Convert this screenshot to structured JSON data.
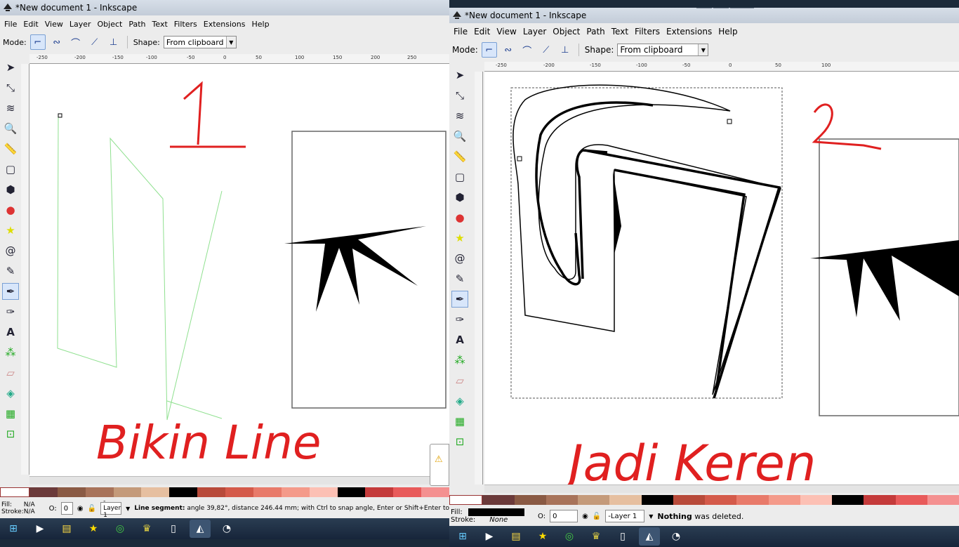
{
  "left": {
    "title": "*New document 1 - Inkscape",
    "menu": [
      "File",
      "Edit",
      "View",
      "Layer",
      "Object",
      "Path",
      "Text",
      "Filters",
      "Extensions",
      "Help"
    ],
    "mode_label": "Mode:",
    "shape_label": "Shape:",
    "shape_value": "From clipboard",
    "ruler_ticks": [
      "-250",
      "-200",
      "-150",
      "-100",
      "-50",
      "0",
      "50",
      "100",
      "150",
      "200",
      "250"
    ],
    "fill_label": "Fill:",
    "fill_value": "N/A",
    "stroke_label": "Stroke:",
    "stroke_value": "N/A",
    "opacity_label": "O:",
    "opacity_value": "0",
    "layer": "-Layer 1",
    "status_bold": "Line segment:",
    "status_text": "angle 39,82°, distance 246.44 mm; with Ctrl to snap angle, Enter or Shift+Enter to",
    "annotation_number": "1",
    "annotation_text": "Bikin Line"
  },
  "right": {
    "title": "*New document 1 - Inkscape",
    "menu": [
      "File",
      "Edit",
      "View",
      "Layer",
      "Object",
      "Path",
      "Text",
      "Filters",
      "Extensions",
      "Help"
    ],
    "mode_label": "Mode:",
    "shape_label": "Shape:",
    "shape_value": "From clipboard",
    "ruler_ticks": [
      "-250",
      "-200",
      "-150",
      "-100",
      "-50",
      "0",
      "50",
      "100"
    ],
    "fill_label": "Fill:",
    "stroke_label": "Stroke:",
    "stroke_value": "None",
    "opacity_label": "O:",
    "opacity_value": "0",
    "layer": "-Layer 1",
    "status_bold": "Nothing",
    "status_text": "was deleted.",
    "annotation_number": "2",
    "annotation_text": "Jadi Keren"
  },
  "palette": [
    "#ffffff",
    "#6b3a3a",
    "#8a5a44",
    "#a8735a",
    "#c49a7a",
    "#e6bfa0",
    "#000000",
    "#b84a3a",
    "#d45a4a",
    "#e87a6a",
    "#f49a8a",
    "#fcc0b4",
    "#000000",
    "#c43a3a",
    "#e85a5a",
    "#f49090"
  ],
  "colors": {
    "annotation": "#e02020",
    "accent": "#1a3c8f"
  },
  "tools": [
    "selector-icon",
    "node-icon",
    "tweak-icon",
    "zoom-icon",
    "measure-icon",
    "rect-icon",
    "box3d-icon",
    "ellipse-icon",
    "star-icon",
    "spiral-icon",
    "pencil-icon",
    "pen-icon",
    "calligraphy-icon",
    "text-icon",
    "spray-icon",
    "eraser-icon",
    "bucket-icon",
    "gradient-icon",
    "connector-icon"
  ]
}
